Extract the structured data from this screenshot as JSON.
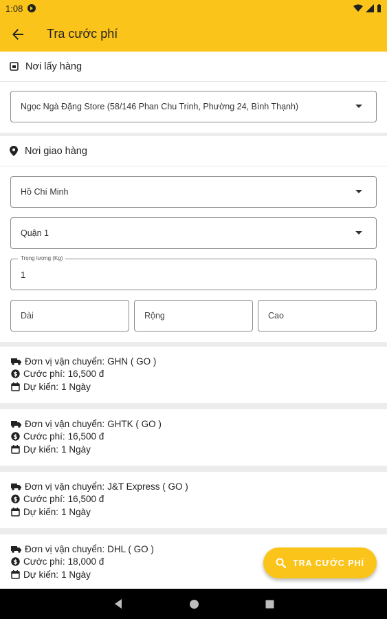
{
  "status_bar": {
    "time": "1:08"
  },
  "app_bar": {
    "title": "Tra cước phí"
  },
  "pickup": {
    "header": "Nơi lấy hàng",
    "store_value": "Ngọc Ngà Đặng Store (58/146 Phan Chu Trinh, Phường 24, Bình Thạnh)"
  },
  "delivery": {
    "header": "Nơi giao hàng",
    "city_value": "Hồ Chí Minh",
    "district_value": "Quận 1",
    "weight_label": "Trọng lượng (Kg)",
    "weight_value": "1",
    "length_placeholder": "Dài",
    "width_placeholder": "Rộng",
    "height_placeholder": "Cao"
  },
  "labels": {
    "carrier": "Đơn vị vận chuyển:",
    "fee": "Cước phí:",
    "eta": "Dự kiến:"
  },
  "results": [
    {
      "carrier": "GHN ( GO )",
      "fee": "16,500 đ",
      "eta": "1 Ngày"
    },
    {
      "carrier": "GHTK ( GO )",
      "fee": "16,500 đ",
      "eta": "1 Ngày"
    },
    {
      "carrier": "J&T Express ( GO )",
      "fee": "16,500 đ",
      "eta": "1 Ngày"
    },
    {
      "carrier": "DHL ( GO )",
      "fee": "18,000 đ",
      "eta": "1 Ngày"
    }
  ],
  "fab": {
    "label": "TRA CƯỚC PHÍ"
  },
  "colors": {
    "accent": "#fbc41b",
    "nav_bar": "#000000",
    "background": "#ececec"
  },
  "icons": {
    "back": "arrow-left-icon",
    "pickup": "store-icon",
    "delivery": "location-pin-icon",
    "carrier": "truck-icon",
    "fee": "dollar-circle-icon",
    "eta": "calendar-icon",
    "search": "search-icon"
  }
}
